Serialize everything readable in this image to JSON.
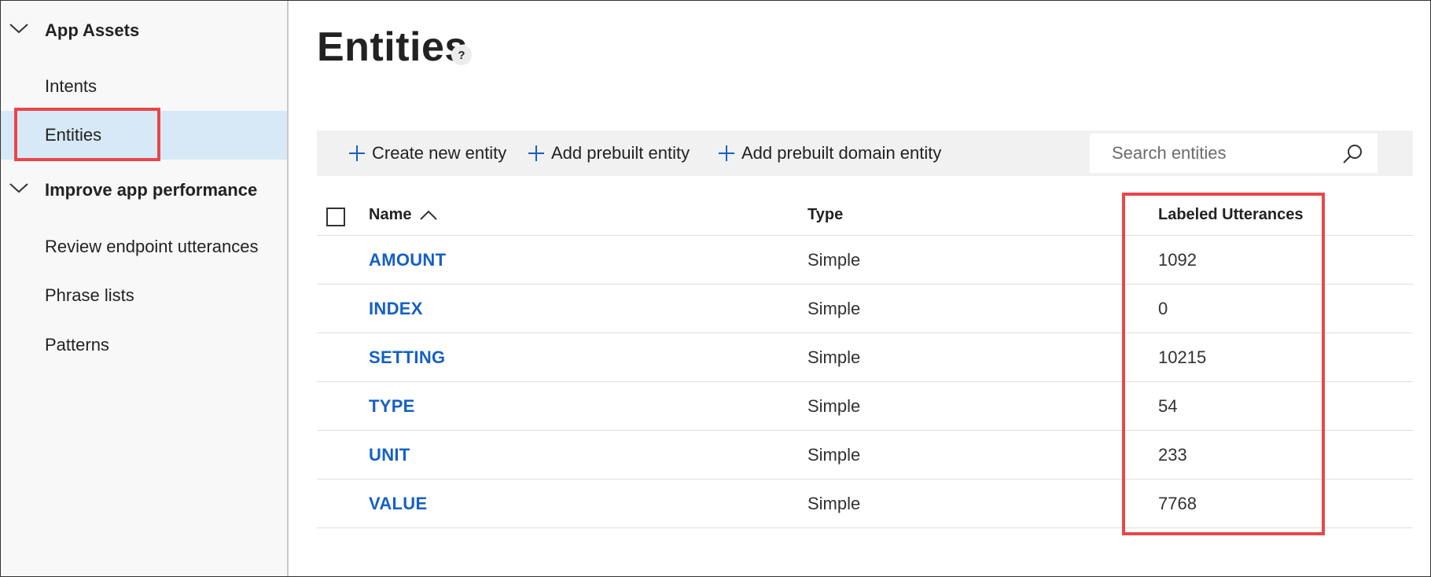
{
  "sidebar": {
    "groups": [
      {
        "label": "App Assets",
        "items": [
          {
            "label": "Intents"
          },
          {
            "label": "Entities"
          }
        ]
      },
      {
        "label": "Improve app performance",
        "items": [
          {
            "label": "Review endpoint utterances"
          },
          {
            "label": "Phrase lists"
          },
          {
            "label": "Patterns"
          }
        ]
      }
    ],
    "selected": "Entities"
  },
  "page": {
    "title": "Entities",
    "help_label": "?"
  },
  "toolbar": {
    "create_label": "Create new entity",
    "add_prebuilt_label": "Add prebuilt entity",
    "add_domain_label": "Add prebuilt domain entity",
    "search_placeholder": "Search entities"
  },
  "table": {
    "columns": [
      "Name",
      "Type",
      "Labeled Utterances"
    ],
    "sort": {
      "column": "Name",
      "direction": "ascending"
    },
    "rows": [
      {
        "name": "AMOUNT",
        "type": "Simple",
        "labeled_utterances": "1092"
      },
      {
        "name": "INDEX",
        "type": "Simple",
        "labeled_utterances": "0"
      },
      {
        "name": "SETTING",
        "type": "Simple",
        "labeled_utterances": "10215"
      },
      {
        "name": "TYPE",
        "type": "Simple",
        "labeled_utterances": "54"
      },
      {
        "name": "UNIT",
        "type": "Simple",
        "labeled_utterances": "233"
      },
      {
        "name": "VALUE",
        "type": "Simple",
        "labeled_utterances": "7768"
      }
    ]
  },
  "colors": {
    "accent_link": "#1560c4",
    "selected_nav": "#d7e9f6",
    "callout_red": "#e8474a",
    "toolbar_bg": "#f1f1f1",
    "sidebar_bg": "#f8f8f8"
  }
}
